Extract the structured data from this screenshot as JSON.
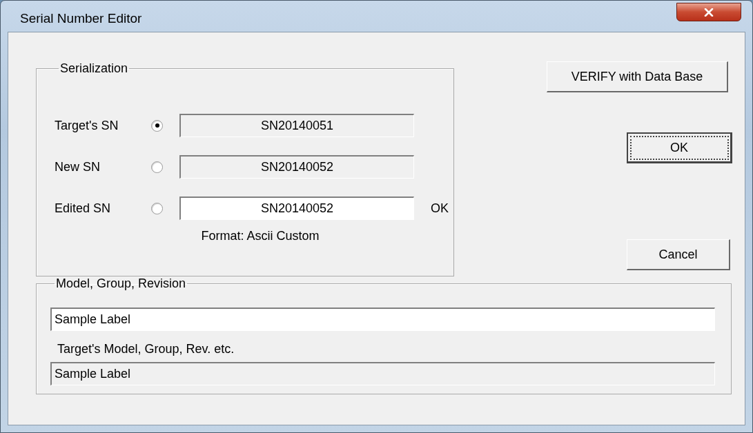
{
  "window": {
    "title": "Serial Number Editor"
  },
  "serialization": {
    "legend": "Serialization",
    "rows": [
      {
        "label": "Target's SN",
        "selected": true,
        "kind": "readonly",
        "value": "SN20140051"
      },
      {
        "label": "New SN",
        "selected": false,
        "kind": "readonly",
        "value": "SN20140052"
      },
      {
        "label": "Edited SN",
        "selected": false,
        "kind": "editable",
        "value": "SN20140052",
        "status": "OK"
      }
    ],
    "format": "Format: Ascii Custom"
  },
  "buttons": [
    {
      "label": "VERIFY with Data Base",
      "focused": false
    },
    {
      "label": "OK",
      "focused": true
    },
    {
      "label": "Cancel",
      "focused": false
    }
  ],
  "model": {
    "legend": "Model, Group, Revision",
    "value": "Sample Label",
    "caption": "Target's Model, Group, Rev. etc.",
    "target_value": "Sample Label"
  }
}
